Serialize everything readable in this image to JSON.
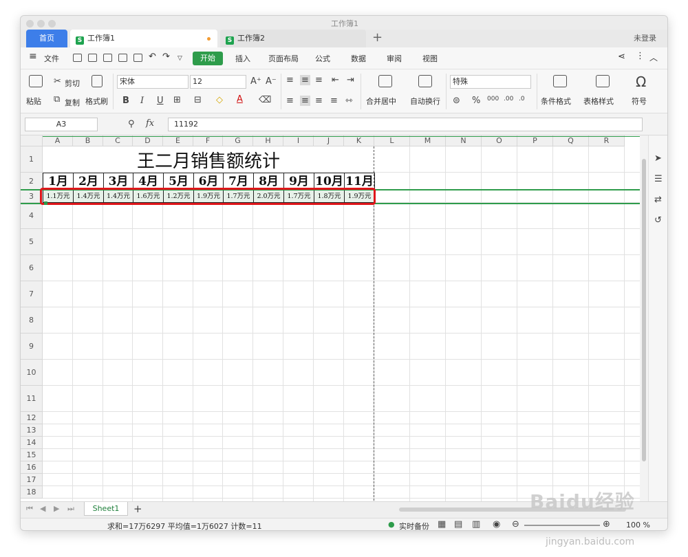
{
  "window": {
    "title": "工作簿1"
  },
  "tabs": {
    "home": "首页",
    "doc1": "工作簿1",
    "doc2": "工作簿2",
    "new_tab": "+",
    "login": "未登录"
  },
  "menu": {
    "file": "文件",
    "start": "开始",
    "insert": "插入",
    "page_layout": "页面布局",
    "formula": "公式",
    "data": "数据",
    "review": "审阅",
    "view": "视图"
  },
  "ribbon": {
    "paste": "粘贴",
    "cut": "剪切",
    "copy": "复制",
    "format_painter": "格式刷",
    "font_name": "宋体",
    "font_size": "12",
    "bold": "B",
    "italic": "I",
    "underline": "U",
    "merge_center": "合并居中",
    "wrap_text": "自动换行",
    "number_format": "特殊",
    "percent": "%",
    "conditional_format": "条件格式",
    "table_style": "表格样式",
    "symbol": "符号"
  },
  "formula_bar": {
    "cell_ref": "A3",
    "fx": "fx",
    "value": "11192"
  },
  "columns": [
    "A",
    "B",
    "C",
    "D",
    "E",
    "F",
    "G",
    "H",
    "I",
    "J",
    "K",
    "L",
    "M",
    "N",
    "O",
    "P",
    "Q",
    "R"
  ],
  "rows": [
    "1",
    "2",
    "3",
    "4",
    "5",
    "6",
    "7",
    "8",
    "9",
    "10",
    "11",
    "12",
    "13",
    "14",
    "15",
    "16",
    "17",
    "18"
  ],
  "sheet": {
    "title": "王二月销售额统计",
    "months": [
      "1月",
      "2月",
      "3月",
      "4月",
      "5月",
      "6月",
      "7月",
      "8月",
      "9月",
      "10月",
      "11月"
    ],
    "sales": [
      "1.1万元",
      "1.4万元",
      "1.4万元",
      "1.6万元",
      "1.2万元",
      "1.9万元",
      "1.7万元",
      "2.0万元",
      "1.7万元",
      "1.8万元",
      "1.9万元"
    ]
  },
  "sheetbar": {
    "sheet1": "Sheet1",
    "add": "+"
  },
  "status": {
    "summary": "求和=17万6297  平均值=1万6027  计数=11",
    "backup": "实时备份",
    "zoom": "100 %"
  },
  "watermark": {
    "brand": "Baidu经验",
    "url": "jingyan.baidu.com"
  },
  "colors": {
    "accent_green": "#2e9c4b",
    "tab_blue": "#3d7ee9",
    "highlight_red": "#e0161a"
  }
}
